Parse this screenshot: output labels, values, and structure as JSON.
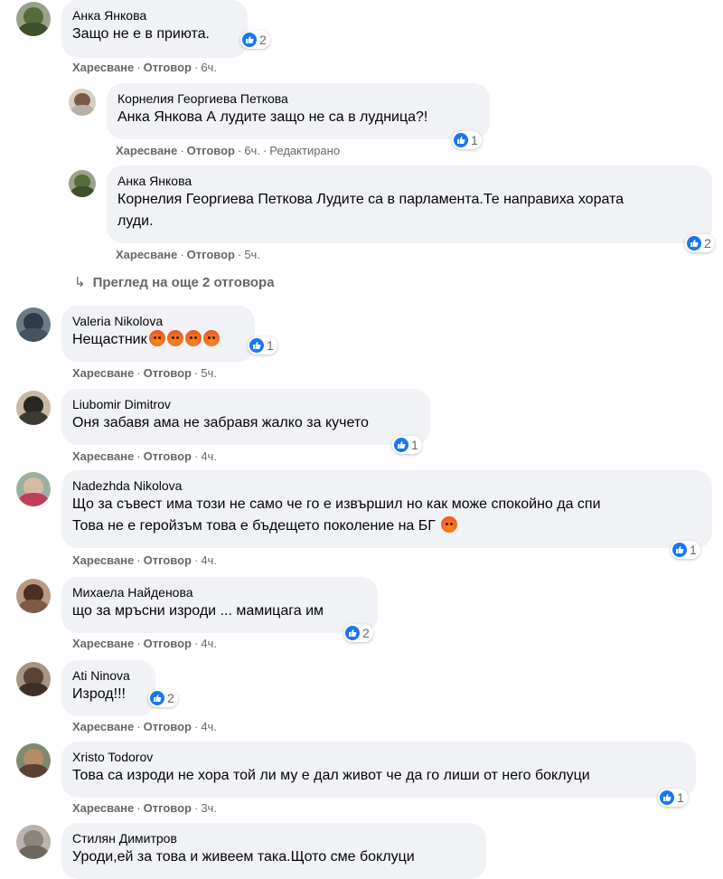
{
  "actions": {
    "like": "Харесване",
    "reply": "Отговор",
    "edited": "Редактирано"
  },
  "comments": [
    {
      "author": "Анка Янкова",
      "text": "Защо не е в приюта.",
      "time": "6ч.",
      "likes": "2"
    },
    {
      "author": "Корнелия Георгиева Петкова",
      "text": "Анка Янкова А лудите защо не са в лудница?!",
      "time": "6ч.",
      "likes": "1"
    },
    {
      "author": "Анка Янкова",
      "text_line1": "Корнелия Георгиева Петкова Лудите са в парламента.Те направиха хората",
      "text_line2": "луди.",
      "time": "5ч.",
      "likes": "2"
    },
    {
      "more": "Преглед на още 2 отговора"
    },
    {
      "author": "Valeria Nikolova",
      "text": "Нещастник",
      "time": "5ч.",
      "likes": "1"
    },
    {
      "author": "Liubomir Dimitrov",
      "text": "Оня забавя ама не забравя жалко за кучето",
      "time": "4ч.",
      "likes": "1"
    },
    {
      "author": "Nadezhda Nikolova",
      "text_line1": "Що за съвест има този не само че го е извършил но как може спокойно да спи",
      "text_line2": "Това не е геройзъм това е бъдещето поколение на БГ",
      "time": "4ч.",
      "likes": "1"
    },
    {
      "author": "Михаела Найденова",
      "text": "що за мръсни изроди ... мамицага им",
      "time": "4ч.",
      "likes": "2"
    },
    {
      "author": "Ati Ninova",
      "text": "Изрод!!!",
      "time": "4ч.",
      "likes": "2"
    },
    {
      "author": "Xristo Todorov",
      "text": "Това са изроди не хора той ли му е дал живот че да го лиши от него боклуци",
      "time": "3ч.",
      "likes": "1"
    },
    {
      "author": "Стилян Димитров",
      "text": "Уроди,ей за това и живеем така.Щото сме боклуци"
    }
  ],
  "colors": {
    "like_blue": "#1877f2",
    "bubble": "#f0f2f5",
    "meta": "#65676b"
  },
  "icons": {
    "like": "like-icon",
    "angry": "angry-icon",
    "reply_arrow": "reply-arrow-icon"
  }
}
